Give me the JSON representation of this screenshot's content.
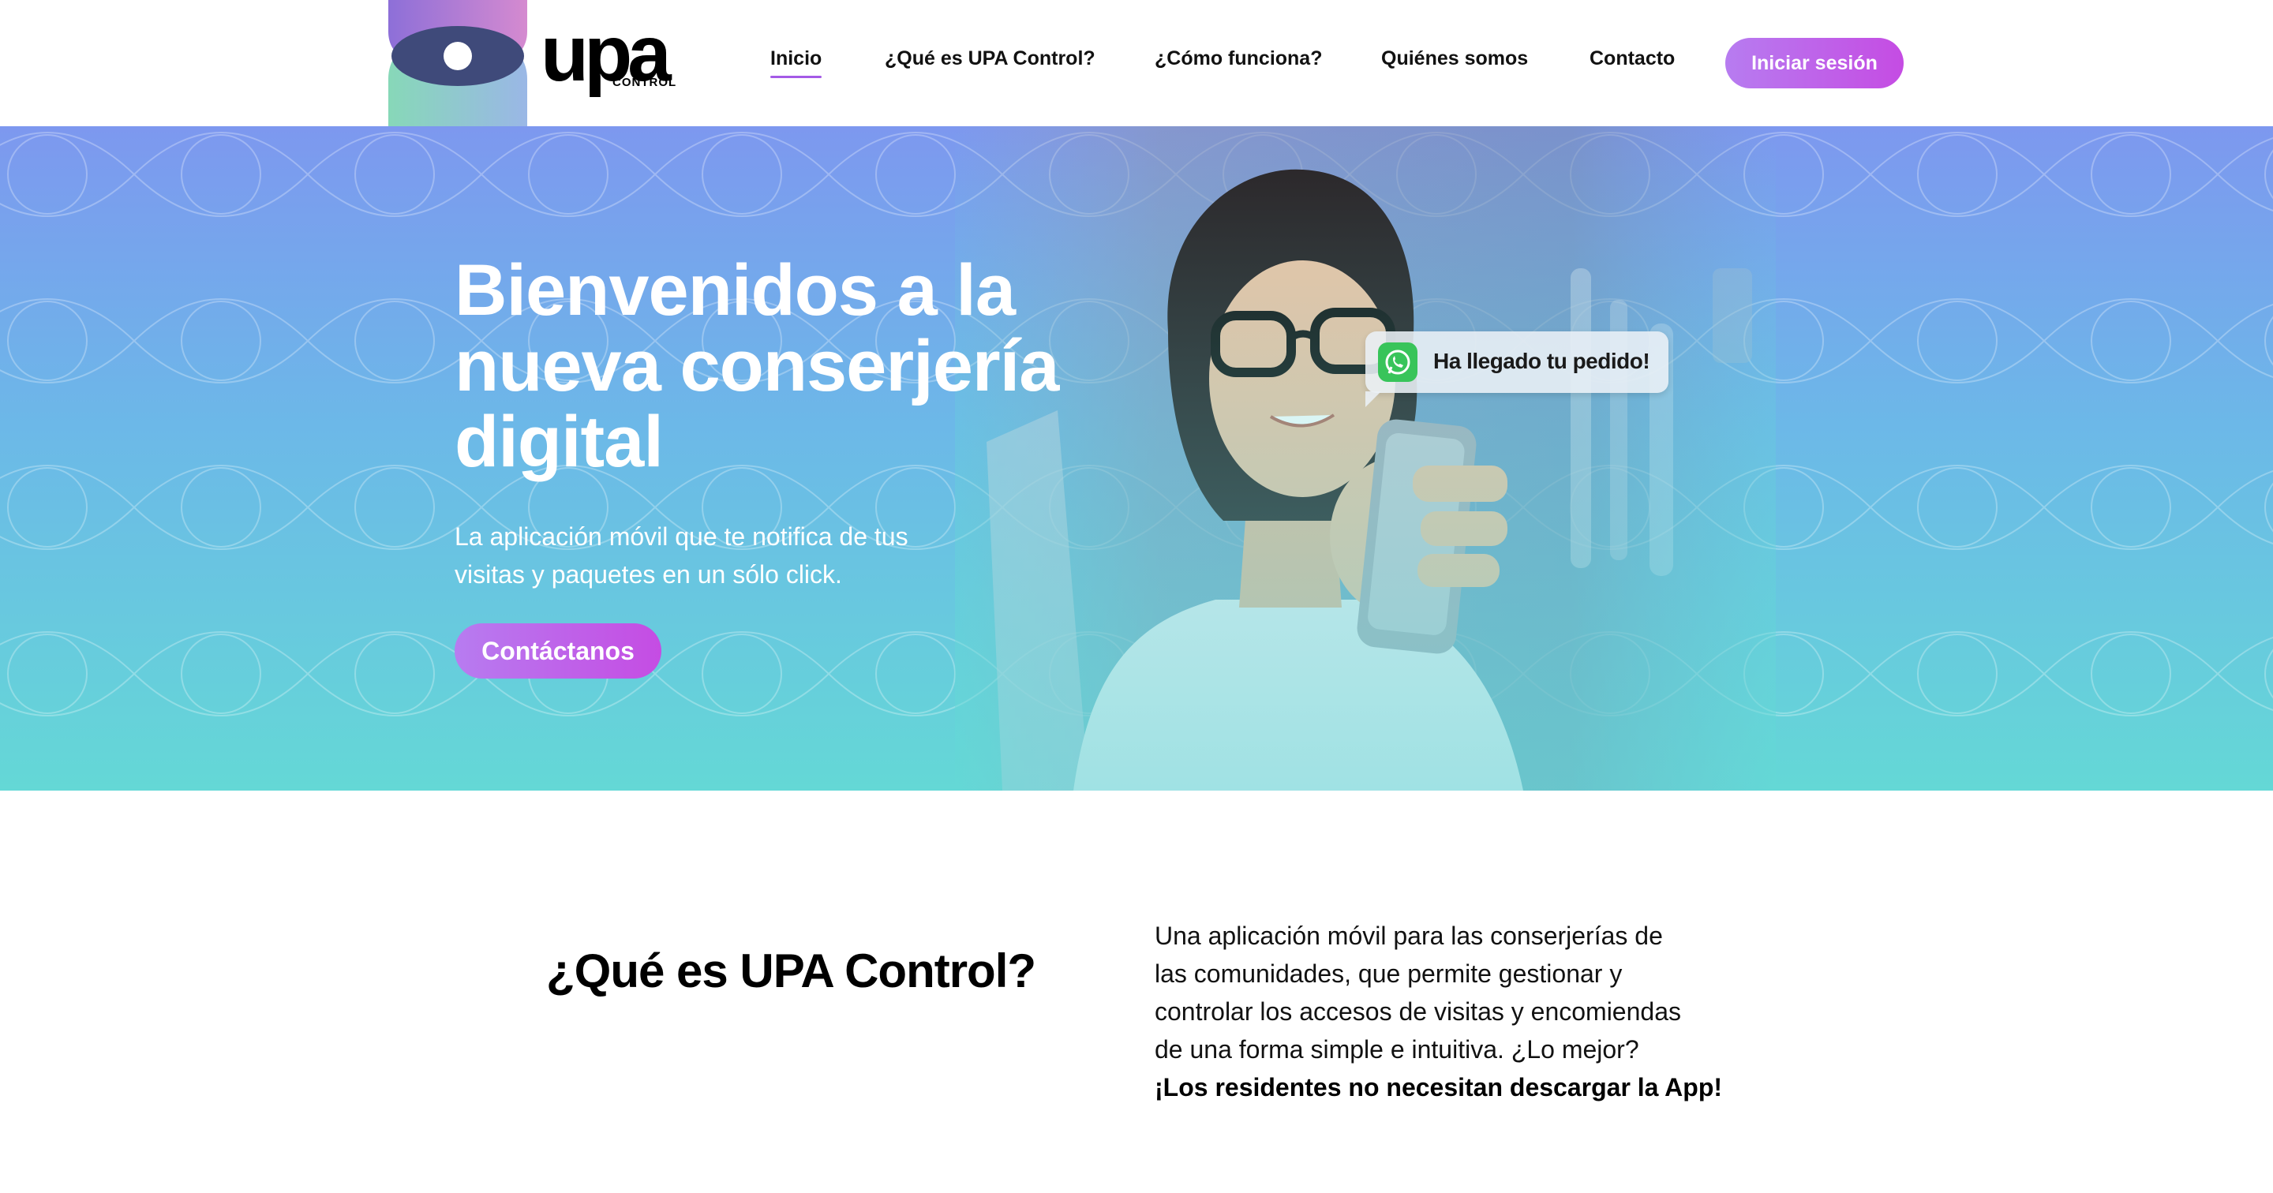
{
  "header": {
    "logo": {
      "word": "upa",
      "sub": "CONTROL"
    },
    "nav": [
      {
        "label": "Inicio",
        "active": true
      },
      {
        "label": "¿Qué es UPA Control?"
      },
      {
        "label": "¿Cómo funciona?"
      },
      {
        "label": "Quiénes somos"
      },
      {
        "label": "Contacto"
      }
    ],
    "login_label": "Iniciar sesión"
  },
  "hero": {
    "title": "Bienvenidos a la nueva conserjería digital",
    "subtitle": "La aplicación móvil que te notifica de tus visitas y paquetes en un sólo click.",
    "cta_label": "Contáctanos",
    "notification": {
      "icon": "whatsapp-icon",
      "text": "Ha llegado tu pedido!"
    }
  },
  "about": {
    "title": "¿Qué es UPA Control?",
    "lines": [
      "Una aplicación móvil para las conserjerías de",
      "las comunidades, que permite gestionar y",
      "controlar los accesos de visitas y encomiendas",
      "de una forma simple e intuitiva. ¿Lo mejor?"
    ],
    "highlight": "¡Los residentes no necesitan descargar la App!"
  },
  "colors": {
    "accent": "#c54ce3",
    "accent_light": "#b77cf0",
    "hero_top": "#7d98ef",
    "hero_bottom": "#64d8d6",
    "whatsapp": "#38c45a"
  }
}
